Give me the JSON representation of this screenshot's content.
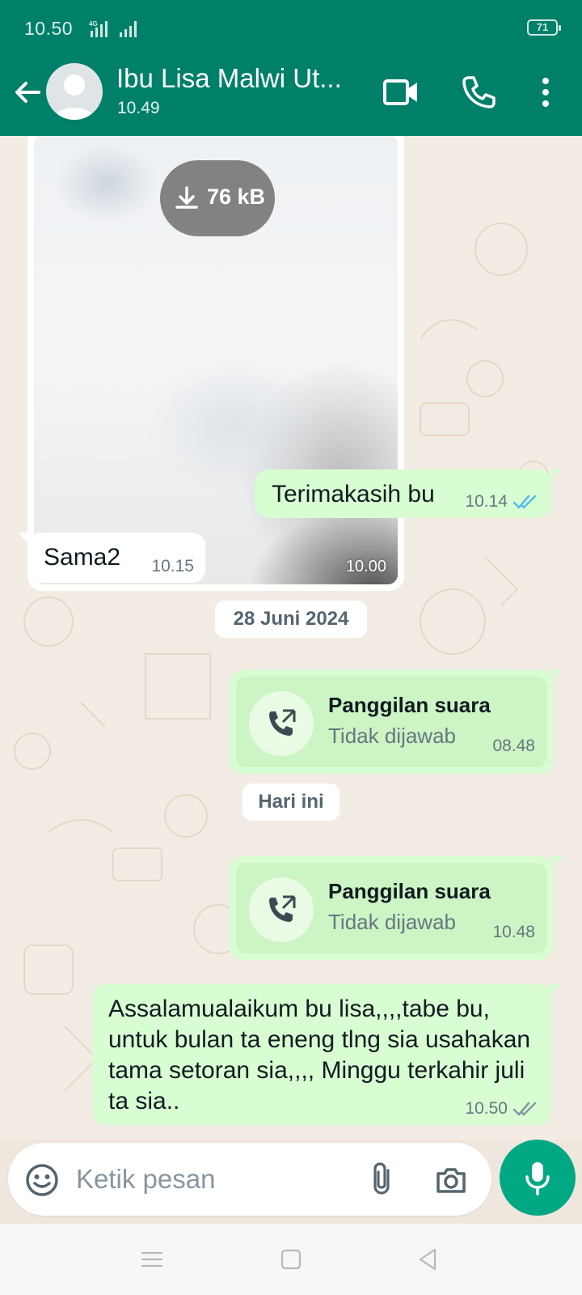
{
  "status_bar": {
    "time": "10.50",
    "network": "4G",
    "battery": "71"
  },
  "header": {
    "contact_name": "Ibu Lisa Malwi Ut...",
    "last_seen": "10.49"
  },
  "messages": {
    "image": {
      "size": "76 kB",
      "time": "10.00"
    },
    "terimakasih": {
      "text": "Terimakasih bu",
      "time": "10.14",
      "read": true
    },
    "sama2": {
      "text": "Sama2",
      "time": "10.15"
    },
    "date_1": "28 Juni 2024",
    "call_1": {
      "title": "Panggilan suara",
      "status": "Tidak dijawab",
      "time": "08.48"
    },
    "date_2": "Hari ini",
    "call_2": {
      "title": "Panggilan suara",
      "status": "Tidak dijawab",
      "time": "10.48"
    },
    "long": {
      "text": "Assalamualaikum bu lisa,,,,tabe bu, untuk bulan ta eneng tlng sia usahakan tama setoran sia,,,, Minggu terkahir juli ta sia..",
      "time": "10.50",
      "read": false
    }
  },
  "composer": {
    "placeholder": "Ketik pesan"
  },
  "colors": {
    "header": "#008069",
    "outgoing": "#d9fdd3",
    "incoming": "#ffffff",
    "accent": "#00a884",
    "read_tick": "#53bdeb"
  },
  "icons": [
    "back-arrow-icon",
    "video-camera-icon",
    "phone-icon",
    "more-vert-icon",
    "download-icon",
    "double-check-icon",
    "outgoing-call-icon",
    "emoji-icon",
    "paperclip-icon",
    "camera-icon",
    "mic-icon"
  ]
}
